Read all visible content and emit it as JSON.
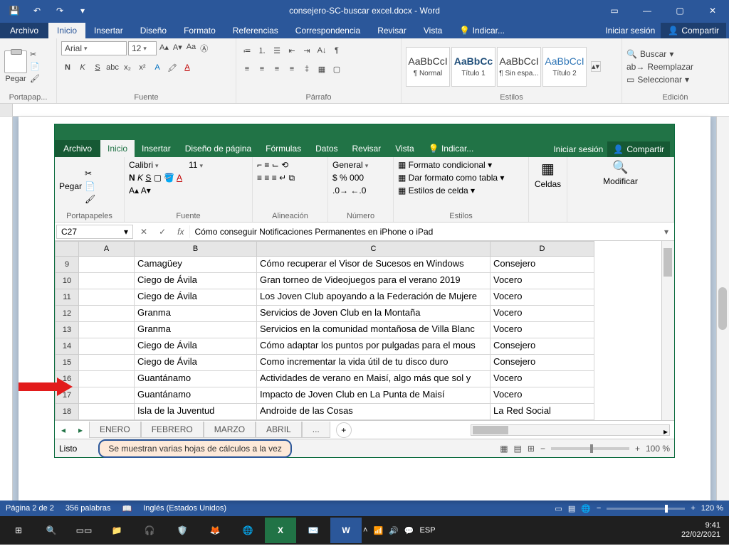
{
  "word": {
    "title": "consejero-SC-buscar excel.docx - Word",
    "tabs": {
      "file": "Archivo",
      "home": "Inicio",
      "insert": "Insertar",
      "design": "Diseño",
      "format": "Formato",
      "references": "Referencias",
      "mailings": "Correspondencia",
      "review": "Revisar",
      "view": "Vista",
      "tell": "Indicar...",
      "signin": "Iniciar sesión",
      "share": "Compartir"
    },
    "ribbon": {
      "clipboard_label": "Portapap...",
      "paste": "Pegar",
      "font_label": "Fuente",
      "font_name": "Arial",
      "font_size": "12",
      "paragraph_label": "Párrafo",
      "styles_label": "Estilos",
      "styles": [
        {
          "prev": "AaBbCcI",
          "name": "¶ Normal"
        },
        {
          "prev": "AaBbCc",
          "name": "Título 1"
        },
        {
          "prev": "AaBbCcI",
          "name": "¶ Sin espa..."
        },
        {
          "prev": "AaBbCcI",
          "name": "Título 2"
        }
      ],
      "editing_label": "Edición",
      "find": "Buscar",
      "replace": "Reemplazar",
      "select": "Seleccionar"
    },
    "status": {
      "page": "Página 2 de 2",
      "words": "356 palabras",
      "lang": "Inglés (Estados Unidos)",
      "zoom": "120 %"
    }
  },
  "excel": {
    "tabs": {
      "file": "Archivo",
      "home": "Inicio",
      "insert": "Insertar",
      "layout": "Diseño de página",
      "formulas": "Fórmulas",
      "data": "Datos",
      "review": "Revisar",
      "view": "Vista",
      "tell": "Indicar...",
      "signin": "Iniciar sesión",
      "share": "Compartir"
    },
    "ribbon": {
      "clipboard_label": "Portapapeles",
      "paste": "Pegar",
      "font_label": "Fuente",
      "font_name": "Calibri",
      "font_size": "11",
      "align_label": "Alineación",
      "number_label": "Número",
      "number_format": "General",
      "styles_label": "Estilos",
      "cond_format": "Formato condicional",
      "as_table": "Dar formato como tabla",
      "cell_styles": "Estilos de celda",
      "cells_label": "Celdas",
      "cells": "Celdas",
      "modify": "Modificar"
    },
    "namebox": "C27",
    "formula": "Cómo conseguir Notificaciones Permanentes en iPhone o iPad",
    "cols": [
      "A",
      "B",
      "C",
      "D"
    ],
    "rows": [
      {
        "n": "9",
        "b": "Camagüey",
        "c": "Cómo recuperar el Visor de Sucesos en Windows",
        "d": "Consejero"
      },
      {
        "n": "10",
        "b": "Ciego de Ávila",
        "c": "Gran torneo de Videojuegos para el verano 2019",
        "d": "Vocero"
      },
      {
        "n": "11",
        "b": "Ciego de Ávila",
        "c": "Los Joven Club apoyando a la Federación de Mujere",
        "d": "Vocero"
      },
      {
        "n": "12",
        "b": "Granma",
        "c": "Servicios de Joven Club en la Montaña",
        "d": "Vocero"
      },
      {
        "n": "13",
        "b": "Granma",
        "c": "Servicios en la comunidad montañosa de Villa Blanc",
        "d": "Vocero"
      },
      {
        "n": "14",
        "b": "Ciego de Ávila",
        "c": "Cómo adaptar los puntos por pulgadas para el mous",
        "d": "Consejero"
      },
      {
        "n": "15",
        "b": "Ciego de Ávila",
        "c": "Como incrementar la vida útil de tu disco duro",
        "d": "Consejero"
      },
      {
        "n": "16",
        "b": "Guantánamo",
        "c": "Actividades de verano en Maisí, algo más que sol y",
        "d": "Vocero"
      },
      {
        "n": "17",
        "b": "Guantánamo",
        "c": "Impacto de Joven Club en La Punta de Maisí",
        "d": "Vocero"
      },
      {
        "n": "18",
        "b": "Isla de la Juventud",
        "c": "Androide de las Cosas",
        "d": "La Red Social"
      }
    ],
    "sheets": [
      "ENERO",
      "FEBRERO",
      "MARZO",
      "ABRIL"
    ],
    "sheets_more": "...",
    "status_ready": "Listo",
    "callout": "Se muestran varias hojas de cálculos a la vez",
    "zoom": "100 %"
  },
  "taskbar": {
    "lang": "ESP",
    "time": "9:41",
    "date": "22/02/2021"
  }
}
